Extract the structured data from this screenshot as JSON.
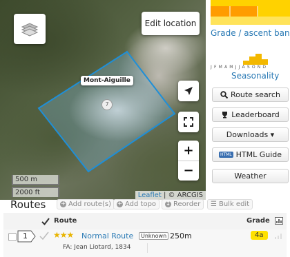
{
  "map": {
    "edit_location_label": "Edit location",
    "marker_label": "Mont-Aiguille",
    "marker_number": "7",
    "scale_metric": "500 m",
    "scale_imperial": "2000 ft",
    "attribution_link": "Leaflet",
    "attribution_sep": " | ",
    "attribution_text": "© ARCGIS",
    "zoom_in_symbol": "+",
    "zoom_out_symbol": "−"
  },
  "sidebar": {
    "grade_link": "Grade / ascent band",
    "season_link": "Seasonality",
    "months": "JFMAMJJASOND",
    "buttons": [
      {
        "label": "Route search",
        "icon": "search-icon"
      },
      {
        "label": "Leaderboard",
        "icon": "trophy-icon"
      },
      {
        "label": "Downloads ▾",
        "icon": ""
      },
      {
        "label": "HTML Guide",
        "icon": "html-icon"
      },
      {
        "label": "Weather",
        "icon": ""
      }
    ],
    "html_icon_text": "HTML"
  },
  "routes": {
    "title": "Routes",
    "add_route": "Add route(s)",
    "add_topo": "Add topo",
    "reorder": "Reorder",
    "bulk_edit": "Bulk edit",
    "col_route": "Route",
    "col_grade": "Grade",
    "rows": [
      {
        "number": "1",
        "stars": "★★★",
        "name": "Normal Route",
        "status": "Unknown",
        "length": "250m",
        "grade": "4a",
        "fa": "FA: Jean Liotard, 1834"
      }
    ]
  },
  "colors": {
    "accent": "#2a7ab5",
    "grade_badge": "#ffe100",
    "star": "#e8b400",
    "route_outline": "#1e8fd8"
  }
}
